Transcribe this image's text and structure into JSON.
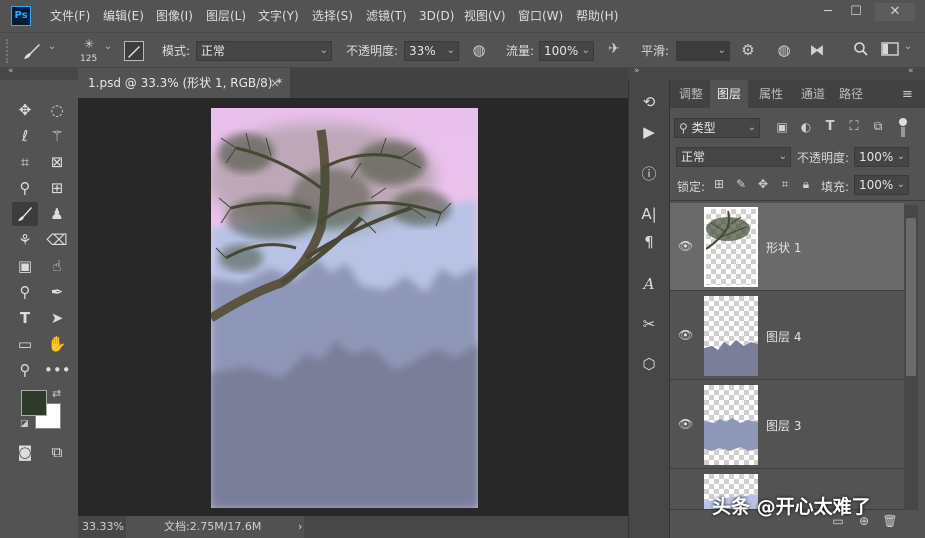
{
  "app": {
    "logo": "Ps"
  },
  "menu": [
    "文件(F)",
    "编辑(E)",
    "图像(I)",
    "图层(L)",
    "文字(Y)",
    "选择(S)",
    "滤镜(T)",
    "3D(D)",
    "视图(V)",
    "窗口(W)",
    "帮助(H)"
  ],
  "window_controls": {
    "minimize": "─",
    "maximize": "☐",
    "close": "✕"
  },
  "options": {
    "brush_size": "125",
    "mode_label": "模式:",
    "mode_value": "正常",
    "opacity_label": "不透明度:",
    "opacity_value": "33%",
    "flow_label": "流量:",
    "flow_value": "100%",
    "smooth_label": "平滑:",
    "smooth_value": ""
  },
  "document": {
    "tab_title": "1.psd @ 33.3% (形状 1, RGB/8) *",
    "tab_close": "×",
    "zoom": "33.33%",
    "doc_info": "文档:2.75M/17.6M",
    "status_arrow": "›"
  },
  "panel": {
    "tabs": [
      "调整",
      "图层",
      "属性",
      "通道",
      "路径"
    ],
    "active_tab": "图层",
    "filter_kind": "类型",
    "blend_mode": "正常",
    "opacity_label": "不透明度:",
    "opacity_value": "100%",
    "lock_label": "锁定:",
    "fill_label": "填充:",
    "fill_value": "100%",
    "layers": [
      {
        "name": "形状 1",
        "visible": true,
        "selected": true
      },
      {
        "name": "图层 4",
        "visible": true,
        "selected": false
      },
      {
        "name": "图层 3",
        "visible": true,
        "selected": false
      },
      {
        "name": "",
        "visible": true,
        "selected": false
      }
    ]
  },
  "colors": {
    "foreground": "#2f3b2a",
    "background": "#ffffff",
    "ui_bg": "#535353",
    "workspace": "#282828",
    "sky_top": "#e9bfeb",
    "sky_bottom": "#eecdf1"
  },
  "watermark": "头条 @开心太难了"
}
